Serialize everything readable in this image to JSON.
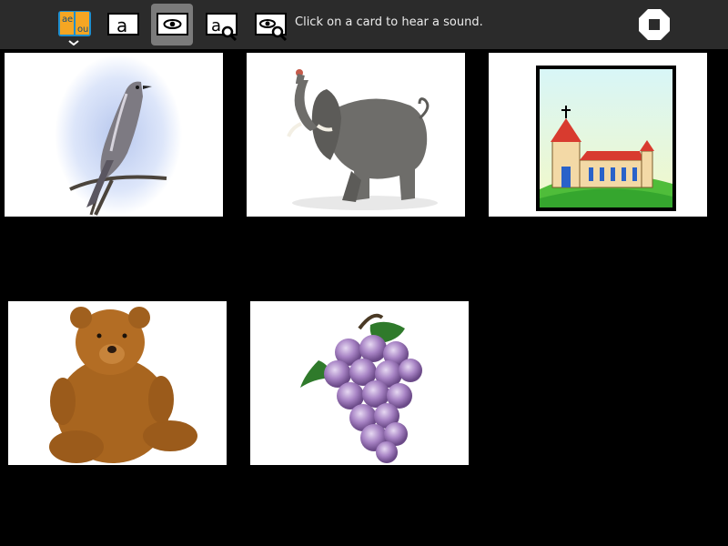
{
  "toolbar": {
    "activity_icon_letters": "ae\nou",
    "letter_glyph": "a",
    "status_text": "Click on a card to hear a sound.",
    "active_tool": "picture-mode"
  },
  "cards": [
    {
      "name": "bird"
    },
    {
      "name": "elephant"
    },
    {
      "name": "church"
    },
    {
      "name": "teddy-bear"
    },
    {
      "name": "grapes"
    }
  ],
  "colors": {
    "toolbar_bg": "#2b2b2b",
    "active_tool_bg": "#7b7b7b",
    "activity_icon": "#f5a623",
    "page_bg": "#000000"
  }
}
